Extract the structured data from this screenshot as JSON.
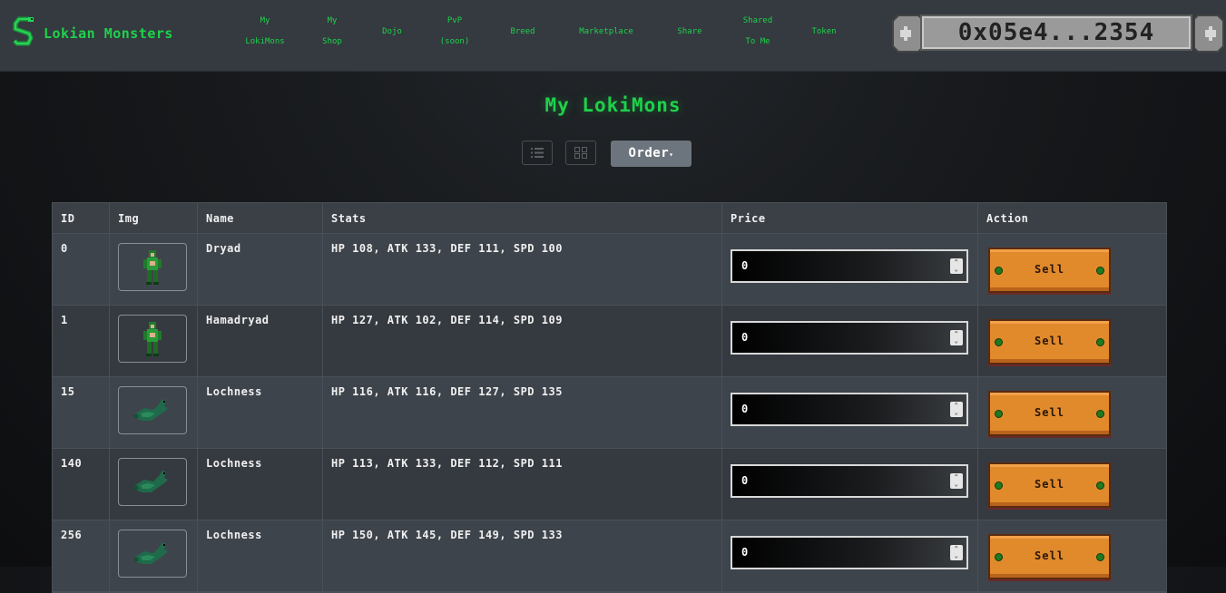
{
  "brand": {
    "name": "Lokian Monsters",
    "icon": "serpent-logo-icon"
  },
  "nav": [
    {
      "lines": [
        "My",
        "LokiMons"
      ]
    },
    {
      "lines": [
        "My",
        "Shop"
      ]
    },
    {
      "lines": [
        "Dojo"
      ]
    },
    {
      "lines": [
        "PvP",
        "(soon)"
      ]
    },
    {
      "lines": [
        "Breed"
      ]
    },
    {
      "lines": [
        "Marketplace"
      ]
    },
    {
      "lines": [
        "Share"
      ]
    },
    {
      "lines": [
        "Shared",
        "To Me"
      ]
    },
    {
      "lines": [
        "Token"
      ]
    }
  ],
  "wallet": {
    "address": "0x05e4...2354"
  },
  "page": {
    "title": "My LokiMons",
    "order_label": "Order",
    "order_caret": "▾"
  },
  "table": {
    "headers": [
      "ID",
      "Img",
      "Name",
      "Stats",
      "Price",
      "Action"
    ],
    "rows": [
      {
        "id": "0",
        "name": "Dryad",
        "stats": "HP 108, ATK 133, DEF 111, SPD 100",
        "price": "0",
        "action": "Sell",
        "sprite": "dryad"
      },
      {
        "id": "1",
        "name": "Hamadryad",
        "stats": "HP 127, ATK 102, DEF 114, SPD 109",
        "price": "0",
        "action": "Sell",
        "sprite": "dryad"
      },
      {
        "id": "15",
        "name": "Lochness",
        "stats": "HP 116, ATK 116, DEF 127, SPD 135",
        "price": "0",
        "action": "Sell",
        "sprite": "lochness"
      },
      {
        "id": "140",
        "name": "Lochness",
        "stats": "HP 113, ATK 133, DEF 112, SPD 111",
        "price": "0",
        "action": "Sell",
        "sprite": "lochness"
      },
      {
        "id": "256",
        "name": "Lochness",
        "stats": "HP 150, ATK 145, DEF 149, SPD 133",
        "price": "0",
        "action": "Sell",
        "sprite": "lochness"
      }
    ]
  },
  "colors": {
    "accent": "#1fd14a",
    "navbar": "#343a40",
    "sell": "#e08a2c"
  }
}
